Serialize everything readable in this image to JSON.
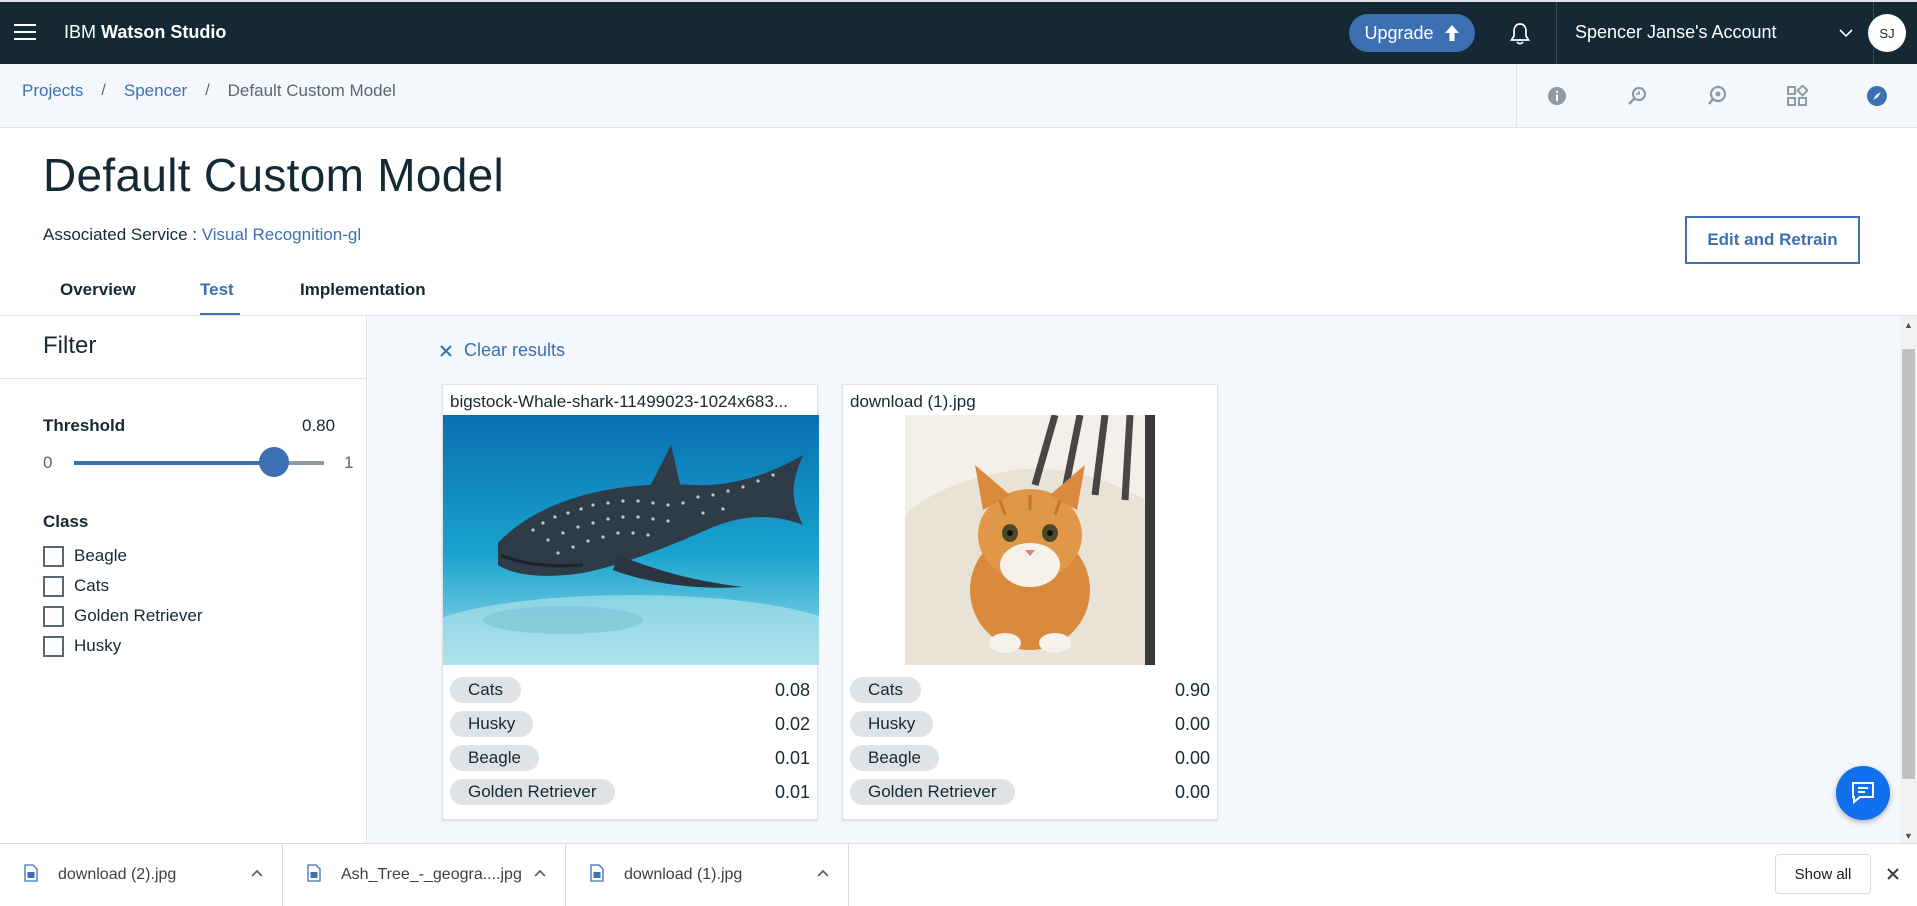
{
  "header": {
    "brand_prefix": "IBM ",
    "brand_bold": "Watson Studio",
    "upgrade_label": "Upgrade",
    "account_label": "Spencer Janse's Account",
    "avatar_initials": "SJ"
  },
  "breadcrumb": {
    "items": [
      "Projects",
      "Spencer",
      "Default Custom Model"
    ],
    "separator": "/"
  },
  "page": {
    "title": "Default Custom Model",
    "service_label": "Associated Service :",
    "service_link": "Visual Recognition-gl",
    "edit_button": "Edit and Retrain"
  },
  "tabs": [
    {
      "label": "Overview",
      "active": false
    },
    {
      "label": "Test",
      "active": true
    },
    {
      "label": "Implementation",
      "active": false
    }
  ],
  "filter": {
    "heading": "Filter",
    "threshold_label": "Threshold",
    "threshold_value": "0.80",
    "threshold_fraction": 0.8,
    "min_label": "0",
    "max_label": "1",
    "class_label": "Class",
    "classes": [
      "Beagle",
      "Cats",
      "Golden Retriever",
      "Husky"
    ]
  },
  "results": {
    "clear_label": "Clear results",
    "cards": [
      {
        "filename": "bigstock-Whale-shark-11499023-1024x683...",
        "scores": [
          {
            "class": "Cats",
            "score": "0.08"
          },
          {
            "class": "Husky",
            "score": "0.02"
          },
          {
            "class": "Beagle",
            "score": "0.01"
          },
          {
            "class": "Golden Retriever",
            "score": "0.01"
          }
        ]
      },
      {
        "filename": "download (1).jpg",
        "scores": [
          {
            "class": "Cats",
            "score": "0.90"
          },
          {
            "class": "Husky",
            "score": "0.00"
          },
          {
            "class": "Beagle",
            "score": "0.00"
          },
          {
            "class": "Golden Retriever",
            "score": "0.00"
          }
        ]
      }
    ]
  },
  "downloads": {
    "items": [
      "download (2).jpg",
      "Ash_Tree_-_geogra....jpg",
      "download (1).jpg"
    ],
    "show_all": "Show all"
  },
  "colors": {
    "header_bg": "#152935",
    "accent": "#3d70b2",
    "chat_button": "#0f6fec"
  },
  "icons": {
    "toolbar": [
      "info-icon",
      "activity-icon",
      "community-icon",
      "apps-icon",
      "compass-icon"
    ]
  }
}
